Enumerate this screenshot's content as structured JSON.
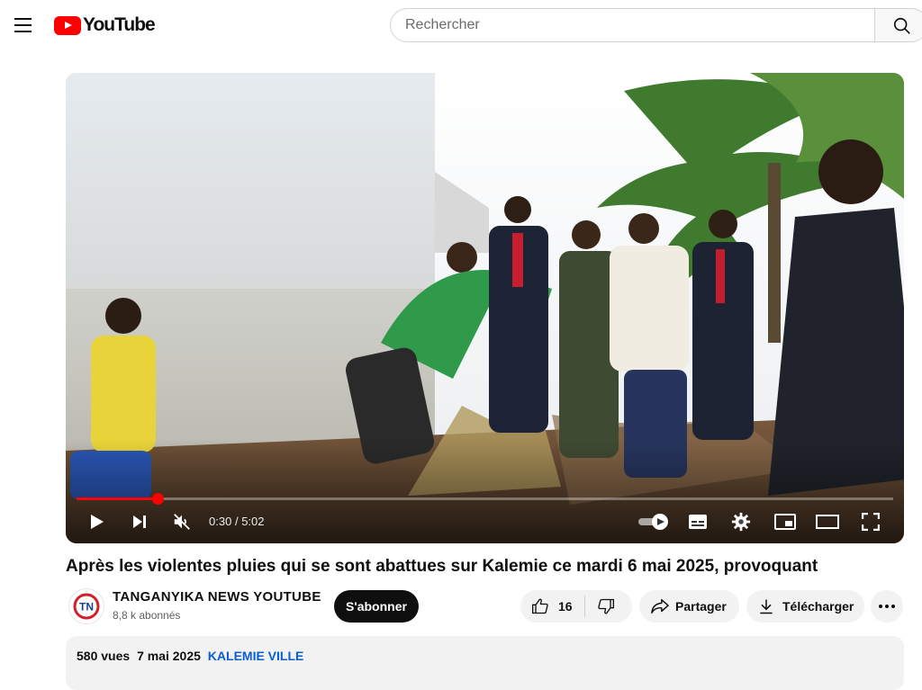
{
  "header": {
    "logo_text": "YouTube",
    "search_placeholder": "Rechercher"
  },
  "player": {
    "time_current": "0:30",
    "time_separator": "/",
    "time_total": "5:02",
    "progress_fraction": 0.0993,
    "muted": true
  },
  "video": {
    "title": "Après les violentes pluies qui se sont abattues sur Kalemie ce mardi 6 mai 2025, provoquant"
  },
  "channel": {
    "name": "TANGANYIKA NEWS YOUTUBE",
    "subscribers": "8,8 k abonnés",
    "avatar_text": "TN",
    "subscribe_label": "S'abonner"
  },
  "actions": {
    "like_count": "16",
    "share_label": "Partager",
    "download_label": "Télécharger"
  },
  "description": {
    "views": "580 vues",
    "date": "7 mai 2025",
    "tag": "KALEMIE VILLE"
  },
  "colors": {
    "brand_red": "#ff0000",
    "link_blue": "#065fd4",
    "subscribe_bg": "#0f0f0f"
  }
}
